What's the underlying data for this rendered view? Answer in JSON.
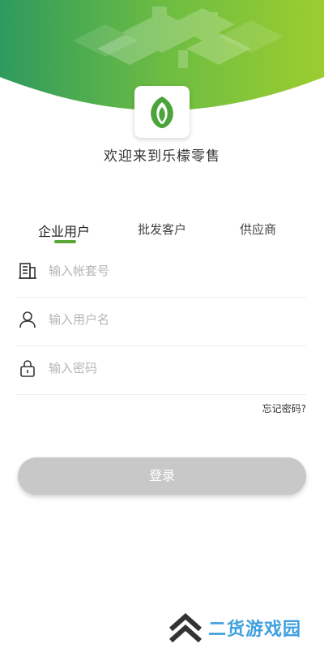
{
  "colors": {
    "accent": "#5aa638",
    "button_disabled": "#c8c8c8",
    "watermark": "#3fa0e0"
  },
  "header": {
    "logo_icon": "leaf-logo-icon"
  },
  "welcome_text": "欢迎来到乐檬零售",
  "tabs": [
    {
      "label": "企业用户",
      "active": true
    },
    {
      "label": "批发客户",
      "active": false
    },
    {
      "label": "供应商",
      "active": false
    }
  ],
  "form": {
    "account_placeholder": "输入帐套号",
    "account_icon": "building-icon",
    "username_placeholder": "输入用户名",
    "username_icon": "user-icon",
    "password_placeholder": "输入密码",
    "password_icon": "lock-icon"
  },
  "forgot_label": "忘记密码?",
  "login_label": "登录",
  "watermark": {
    "text": "二货游戏园",
    "icon": "chevron-up-logo-icon"
  }
}
